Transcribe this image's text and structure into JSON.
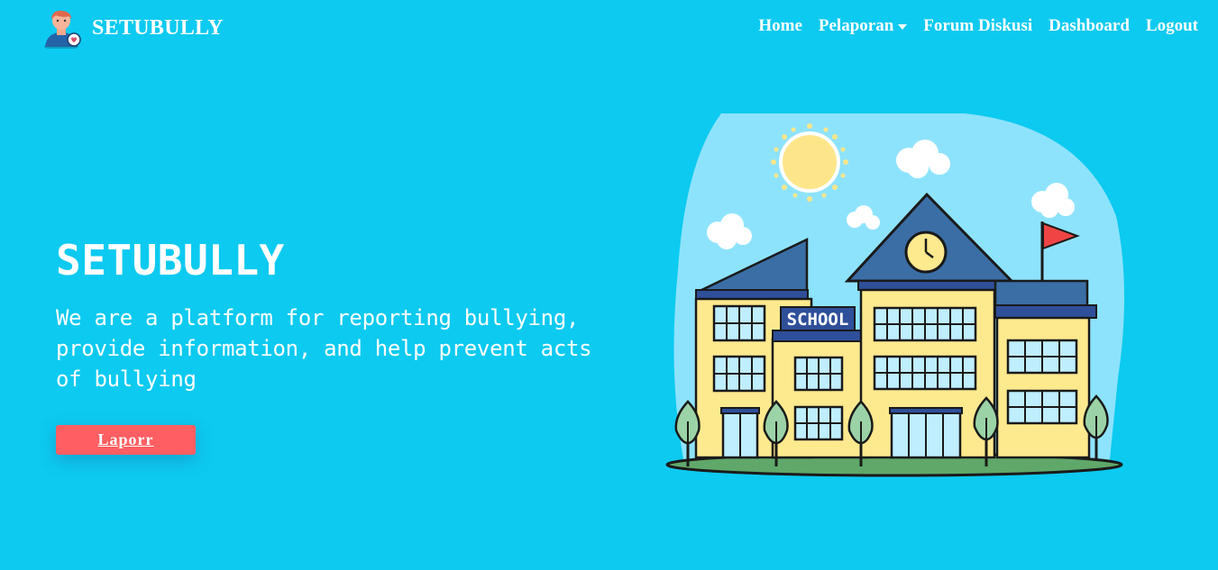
{
  "brand": {
    "name": "SETUBULLY",
    "logo_icon": "user-avatar-logo-icon"
  },
  "nav": {
    "items": [
      {
        "label": "Home"
      },
      {
        "label": "Pelaporan",
        "has_dropdown": true
      },
      {
        "label": "Forum Diskusi"
      },
      {
        "label": "Dashboard"
      },
      {
        "label": "Logout"
      }
    ]
  },
  "hero": {
    "title": "SETUBULLY",
    "description": "We are a platform for reporting bullying, provide information, and help prevent acts of bullying",
    "cta_label": "Laporr"
  },
  "illustration": {
    "sign_text": "SCHOOL",
    "icon": "school-building-illustration"
  },
  "colors": {
    "background": "#0dcaf0",
    "cta": "#ff5e62",
    "text": "#ffffff"
  }
}
